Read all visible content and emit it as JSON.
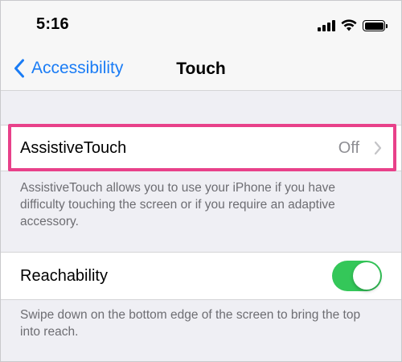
{
  "status_bar": {
    "time": "5:16"
  },
  "nav": {
    "back_label": "Accessibility",
    "title": "Touch"
  },
  "assistive_touch": {
    "label": "AssistiveTouch",
    "value": "Off",
    "footer": "AssistiveTouch allows you to use your iPhone if you have difficulty touching the screen or if you require an adaptive accessory."
  },
  "reachability": {
    "label": "Reachability",
    "enabled": true,
    "footer": "Swipe down on the bottom edge of the screen to bring the top into reach."
  },
  "colors": {
    "accent": "#1a7cf5",
    "toggle_on": "#34c759",
    "highlight": "#e8418a",
    "grouped_background": "#efeff4"
  }
}
